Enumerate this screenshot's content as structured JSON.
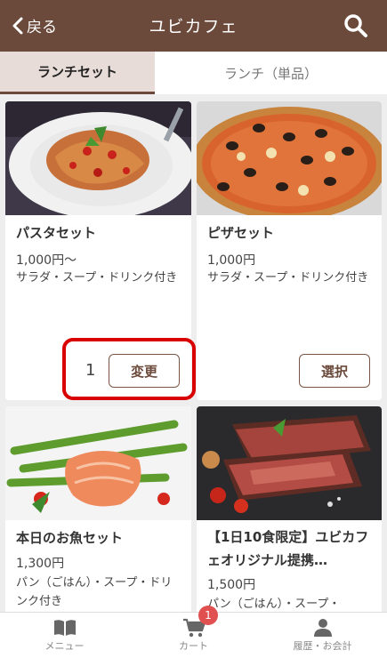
{
  "header": {
    "back_label": "戻る",
    "title": "ユビカフェ"
  },
  "tabs": [
    {
      "label": "ランチセット",
      "active": true
    },
    {
      "label": "ランチ（単品）",
      "active": false
    }
  ],
  "cards": [
    {
      "name": "パスタセット",
      "price": "1,000円〜",
      "desc": "サラダ・スープ・ドリンク付き",
      "quantity": "1",
      "button": "変更"
    },
    {
      "name": "ピザセット",
      "price": "1,000円",
      "desc": "サラダ・スープ・ドリンク付き",
      "button": "選択"
    },
    {
      "name": "本日のお魚セット",
      "price": "1,300円",
      "desc": "パン（ごはん）・スープ・ドリンク付き"
    },
    {
      "name": "【1日10食限定】ユビカフェオリジナル提携…",
      "price": "1,500円",
      "desc": "パン（ごはん）・スープ・"
    }
  ],
  "bottom_nav": [
    {
      "label": "メニュー",
      "icon": "book-icon"
    },
    {
      "label": "カート",
      "icon": "cart-icon",
      "badge": "1"
    },
    {
      "label": "履歴・お会計",
      "icon": "person-icon"
    }
  ],
  "colors": {
    "brand": "#6b4a3b",
    "active_tab": "#e8dcd8",
    "highlight": "#d80000",
    "badge": "#e05050"
  }
}
